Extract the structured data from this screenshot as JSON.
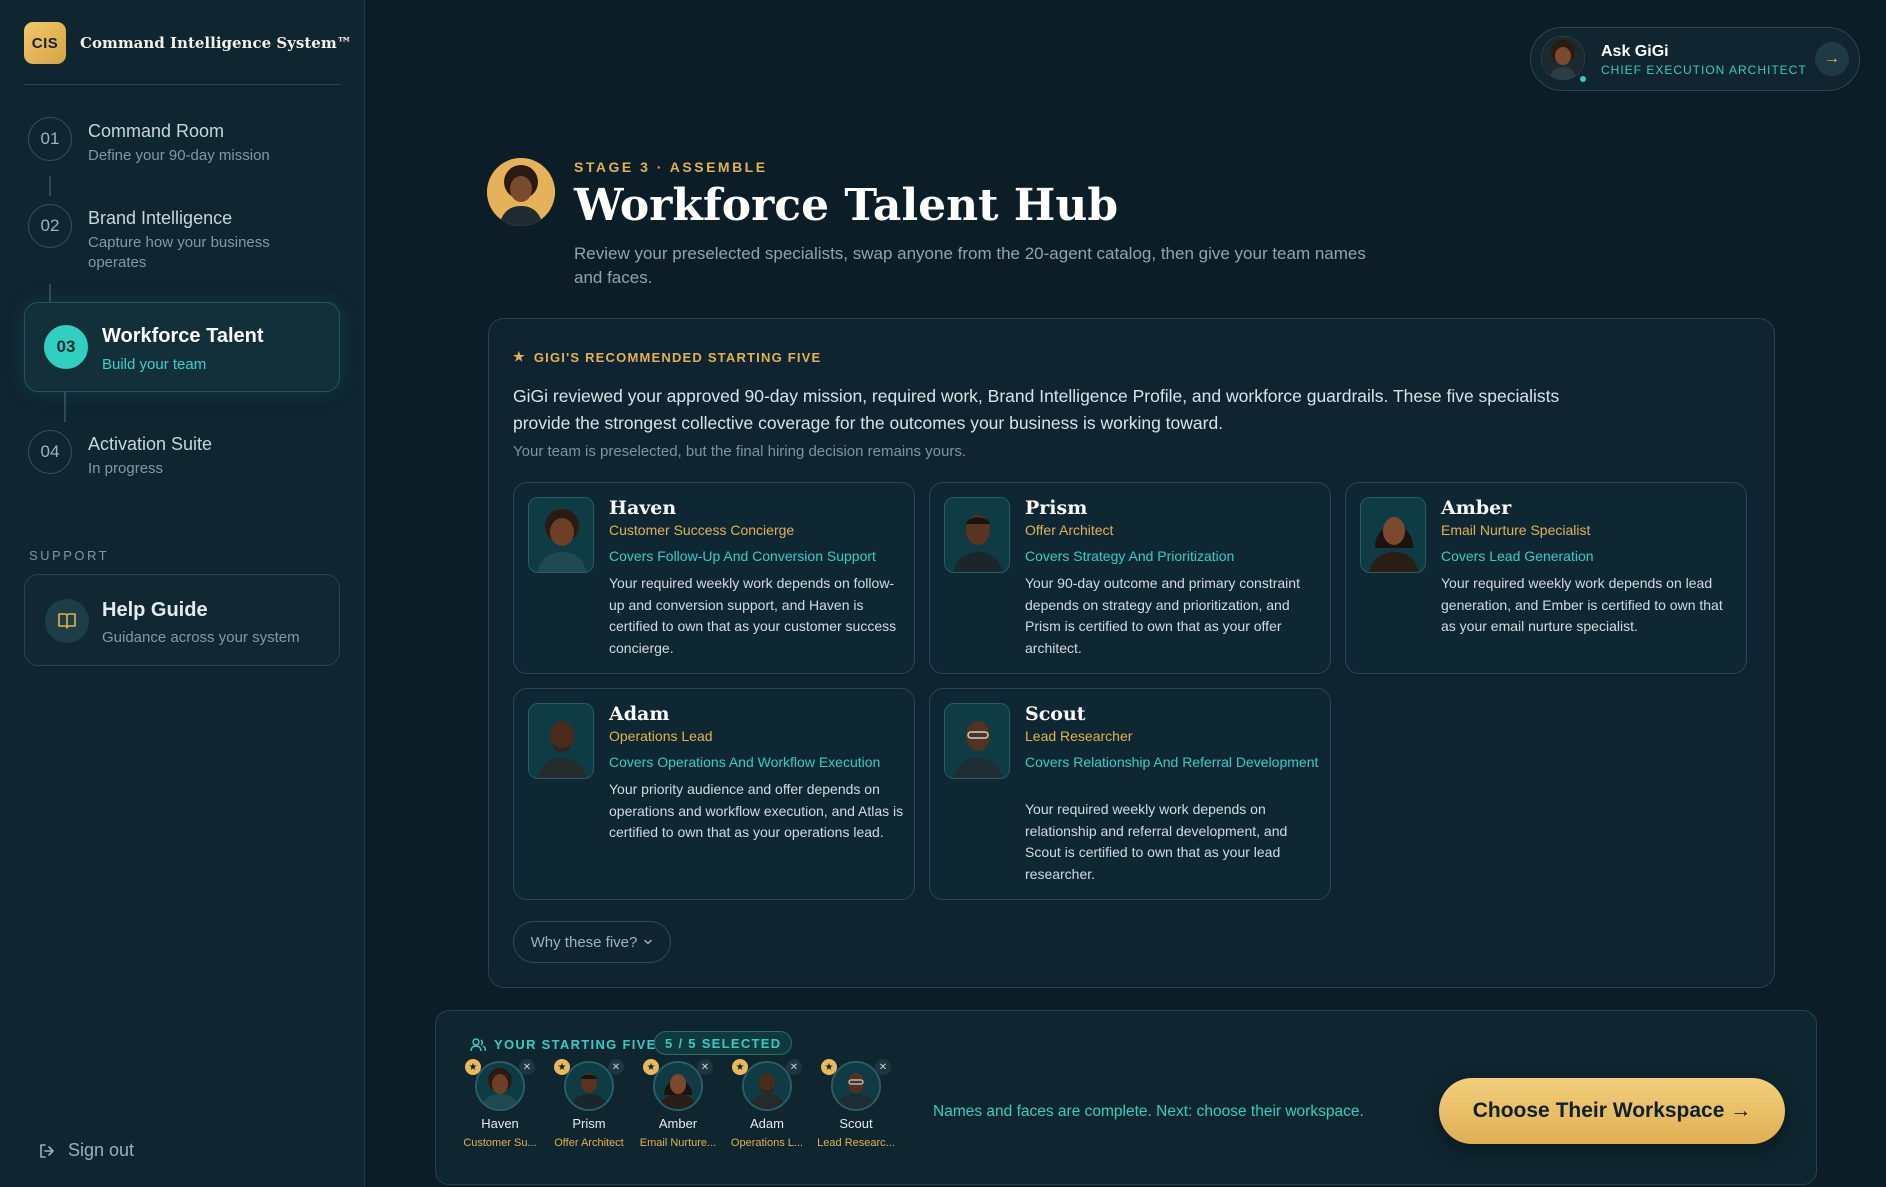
{
  "brand": {
    "logo": "CIS",
    "name": "Command Intelligence System™"
  },
  "steps": [
    {
      "num": "01",
      "title": "Command Room",
      "sub": "Define your 90-day mission"
    },
    {
      "num": "02",
      "title": "Brand Intelligence",
      "sub": "Capture how your business operates"
    },
    {
      "num": "03",
      "title": "Workforce Talent",
      "sub": "Build your team"
    },
    {
      "num": "04",
      "title": "Activation Suite",
      "sub": "In progress"
    }
  ],
  "support": {
    "label": "SUPPORT",
    "help_title": "Help Guide",
    "help_sub": "Guidance across your system",
    "icon": "book-icon"
  },
  "signout": "Sign out",
  "ask": {
    "name": "Ask GiGi",
    "role": "CHIEF EXECUTION ARCHITECT"
  },
  "hero": {
    "kicker": "STAGE 3 · ASSEMBLE",
    "title": "Workforce Talent Hub",
    "sub": "Review your preselected specialists, swap anyone from the 20-agent catalog, then give your team names and faces."
  },
  "rec": {
    "kicker": "GIGI'S RECOMMENDED STARTING FIVE",
    "intro": "GiGi reviewed your approved 90-day mission, required work, Brand Intelligence Profile, and workforce guardrails. These five specialists provide the strongest collective coverage for the outcomes your business is working toward.",
    "note": "Your team is preselected, but the final hiring decision remains yours.",
    "why": "Why these five?"
  },
  "cards": [
    {
      "name": "Haven",
      "role": "Customer Success Concierge",
      "covers": "Covers Follow-Up And Conversion Support",
      "desc": "Your required weekly work depends on follow-up and conversion support, and Haven is certified to own that as your customer success concierge."
    },
    {
      "name": "Prism",
      "role": "Offer Architect",
      "covers": "Covers Strategy And Prioritization",
      "desc": "Your 90-day outcome and primary constraint depends on strategy and prioritization, and Prism is certified to own that as your offer architect."
    },
    {
      "name": "Amber",
      "role": "Email Nurture Specialist",
      "covers": "Covers Lead Generation",
      "desc": "Your required weekly work depends on lead generation, and Ember is certified to own that as your email nurture specialist."
    },
    {
      "name": "Adam",
      "role": "Operations Lead",
      "covers": "Covers Operations And Workflow Execution",
      "desc": "Your priority audience and offer depends on operations and workflow execution, and Atlas is certified to own that as your operations lead."
    },
    {
      "name": "Scout",
      "role": "Lead Researcher",
      "covers": "Covers Relationship And Referral Development",
      "desc": "Your required weekly work depends on relationship and referral development, and Scout is certified to own that as your lead researcher."
    }
  ],
  "tray": {
    "kicker": "YOUR STARTING FIVE",
    "badge": "5 / 5 SELECTED",
    "members": [
      {
        "name": "Haven",
        "role": "Customer Su..."
      },
      {
        "name": "Prism",
        "role": "Offer Architect"
      },
      {
        "name": "Amber",
        "role": "Email Nurture..."
      },
      {
        "name": "Adam",
        "role": "Operations L..."
      },
      {
        "name": "Scout",
        "role": "Lead Researc..."
      }
    ],
    "msg": "Names and faces are complete. Next: choose their workspace.",
    "cta": "Choose Their Workspace →"
  }
}
